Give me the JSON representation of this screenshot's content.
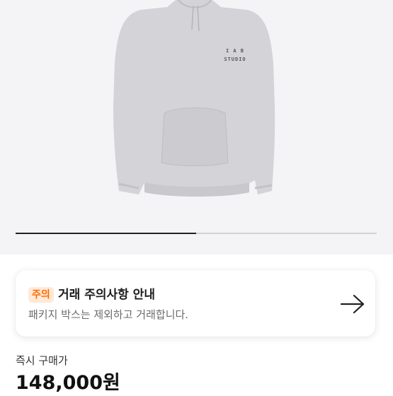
{
  "product": {
    "logo_line1": "I A B",
    "logo_line2": "STUDIO",
    "carousel_progress": 0.5
  },
  "notice": {
    "badge": "주의",
    "title": "거래 주의사항 안내",
    "description": "패키지 박스는 제외하고 거래합니다.",
    "arrow_icon": "arrow-right-icon"
  },
  "price": {
    "label": "즉시 구매가",
    "value": "148,000원"
  }
}
